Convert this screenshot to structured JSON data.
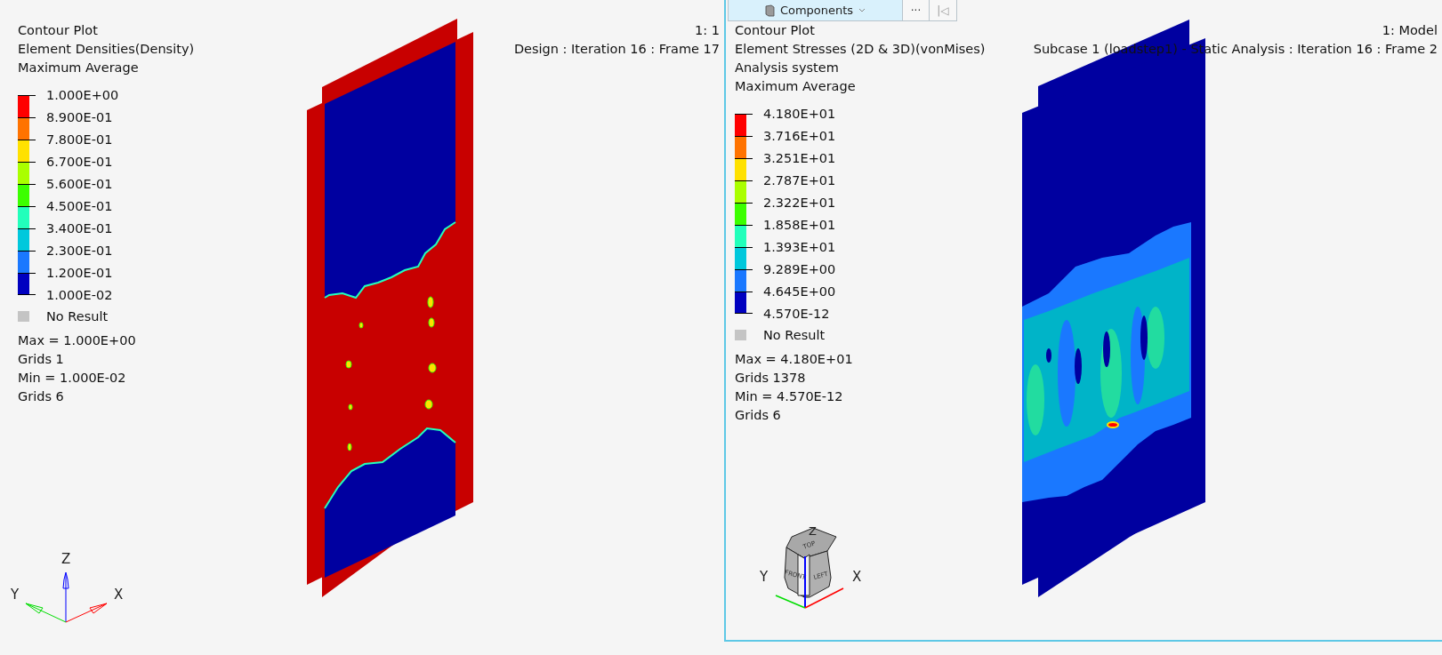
{
  "toolbar": {
    "components_label": "Components",
    "more_label": "···",
    "first_label": "|◁"
  },
  "viewports": [
    {
      "kind": "density",
      "selected": false,
      "window_label": "1: 1",
      "result_label": "Design : Iteration 16 : Frame 17",
      "legend_title": [
        "Contour Plot",
        "Element Densities(Density)",
        "Maximum Average"
      ],
      "ticks": [
        "1.000E+00",
        "8.900E-01",
        "7.800E-01",
        "6.700E-01",
        "5.600E-01",
        "4.500E-01",
        "3.400E-01",
        "2.300E-01",
        "1.200E-01",
        "1.000E-02"
      ],
      "bands": [
        {
          "color": "#ff0000"
        },
        {
          "color": "#ff7300"
        },
        {
          "color": "#ffe100"
        },
        {
          "color": "#aaff00"
        },
        {
          "color": "#3cff00"
        },
        {
          "color": "#22ffbb"
        },
        {
          "color": "#00c8dc"
        },
        {
          "color": "#1a78ff"
        },
        {
          "color": "#0000c0"
        }
      ],
      "no_result": "No Result",
      "stats": [
        "Max =  1.000E+00",
        "Grids 1",
        "Min =  1.000E-02",
        "Grids 6"
      ],
      "axes": {
        "x": "X",
        "y": "Y",
        "z": "Z"
      }
    },
    {
      "kind": "stress",
      "selected": true,
      "window_label": "1: Model",
      "result_label": "Subcase 1 (loadstep1) - Static Analysis : Iteration 16 : Frame 2",
      "legend_title": [
        "Contour Plot",
        "Element Stresses (2D & 3D)(vonMises)",
        "Analysis system",
        "Maximum Average"
      ],
      "ticks": [
        "4.180E+01",
        "3.716E+01",
        "3.251E+01",
        "2.787E+01",
        "2.322E+01",
        "1.858E+01",
        "1.393E+01",
        "9.289E+00",
        "4.645E+00",
        "4.570E-12"
      ],
      "bands": [
        {
          "color": "#ff0000"
        },
        {
          "color": "#ff7300"
        },
        {
          "color": "#ffe100"
        },
        {
          "color": "#aaff00"
        },
        {
          "color": "#3cff00"
        },
        {
          "color": "#22ffbb"
        },
        {
          "color": "#00c8dc"
        },
        {
          "color": "#1a78ff"
        },
        {
          "color": "#0000c0"
        }
      ],
      "no_result": "No Result",
      "stats": [
        "Max =  4.180E+01",
        "Grids 1378",
        "Min =  4.570E-12",
        "Grids 6"
      ],
      "axes": {
        "x": "X",
        "y": "Y",
        "z": "Z"
      },
      "cube_faces": [
        "TOP",
        "FRONT",
        "LEFT"
      ]
    }
  ]
}
